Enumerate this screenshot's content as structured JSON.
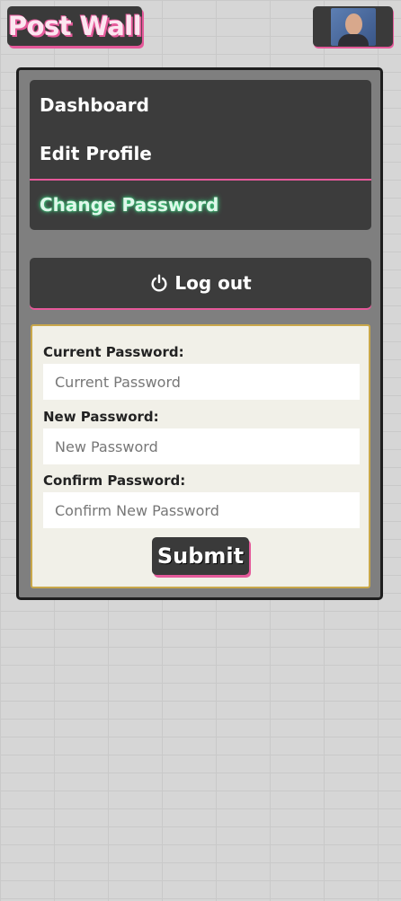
{
  "brand": {
    "title": "Post Wall"
  },
  "user": {
    "avatar_icon": "user-avatar-photo"
  },
  "nav": {
    "items": [
      {
        "label": "Dashboard",
        "active": false
      },
      {
        "label": "Edit Profile",
        "active": false
      },
      {
        "label": "Change Password",
        "active": true
      }
    ]
  },
  "logout": {
    "label": "Log out",
    "icon": "power-icon"
  },
  "form": {
    "current_label": "Current Password:",
    "current_placeholder": "Current Password",
    "new_label": "New Password:",
    "new_placeholder": "New Password",
    "confirm_label": "Confirm Password:",
    "confirm_placeholder": "Confirm New Password",
    "submit_label": "Submit"
  },
  "colors": {
    "accent_pink": "#e5599a",
    "active_glow": "#3ddc84",
    "dark_panel": "#3c3c3c",
    "form_border": "#c9a74a"
  }
}
